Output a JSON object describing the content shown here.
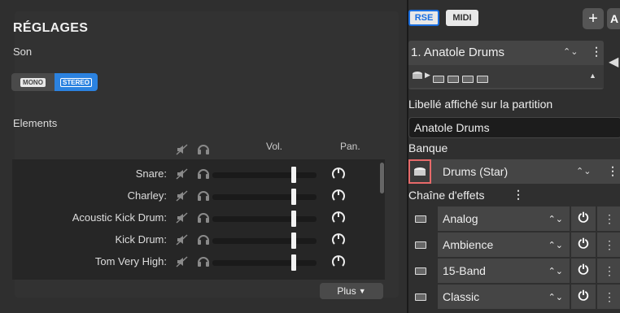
{
  "settings": {
    "title": "RÉGLAGES",
    "son_label": "Son",
    "mono_label": "MONO",
    "stereo_label": "STEREO",
    "elements_label": "Elements",
    "vol_header": "Vol.",
    "pan_header": "Pan.",
    "rows": [
      {
        "label": "Snare:",
        "volume": 0.78
      },
      {
        "label": "Charley:",
        "volume": 0.78
      },
      {
        "label": "Acoustic Kick Drum:",
        "volume": 0.78
      },
      {
        "label": "Kick Drum:",
        "volume": 0.78
      },
      {
        "label": "Tom Very High:",
        "volume": 0.78
      }
    ],
    "more_button": "Plus"
  },
  "panel": {
    "tab_rse": "RSE",
    "tab_midi": "MIDI",
    "add_button": "+",
    "a_button": "A",
    "track_name": "1. Anatole Drums",
    "label_text_caption": "Libellé affiché sur la partition",
    "label_value": "Anatole Drums",
    "bank_label": "Banque",
    "bank_value": "Drums (Star)",
    "chain_label": "Chaîne d'effets",
    "effects": [
      {
        "name": "Analog"
      },
      {
        "name": "Ambience"
      },
      {
        "name": "15-Band"
      },
      {
        "name": "Classic"
      }
    ]
  },
  "colors": {
    "accent": "#2b82e0",
    "highlight": "#e76a6a"
  }
}
